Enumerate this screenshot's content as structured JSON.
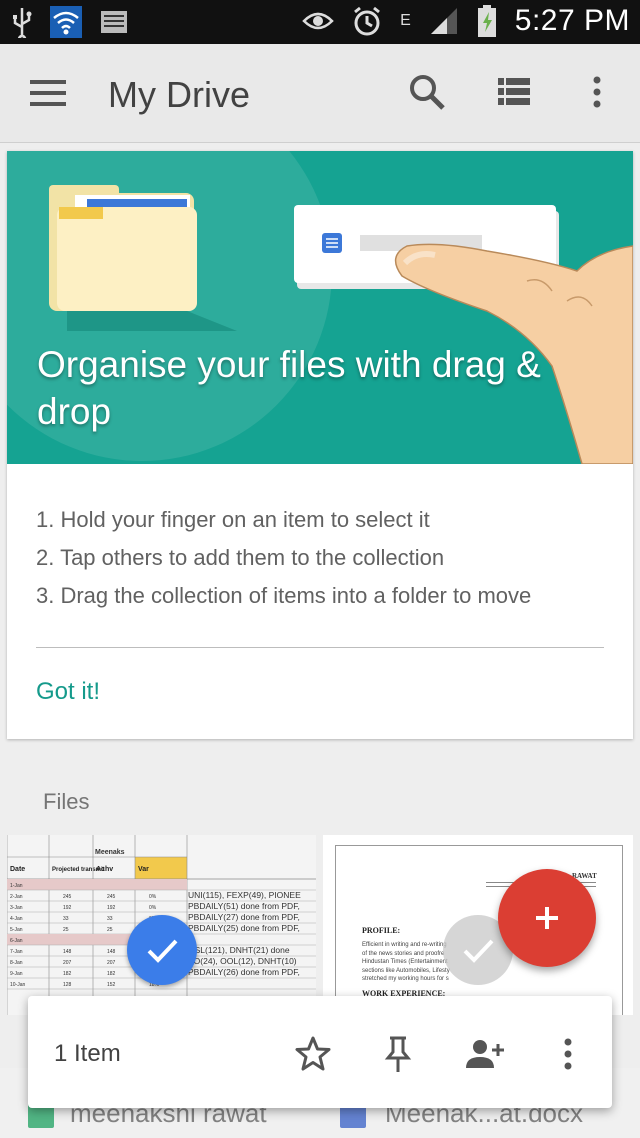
{
  "status_bar": {
    "time": "5:27 PM",
    "network": "E"
  },
  "app_bar": {
    "title": "My Drive"
  },
  "banner": {
    "title": "Organise your files with drag & drop"
  },
  "steps": [
    "1. Hold your finger on an item to select it",
    "2. Tap others to add them to the collection",
    "3. Drag the collection of items into a folder to move"
  ],
  "got_it_label": "Got it!",
  "files_section_label": "Files",
  "spreadsheet": {
    "header_group": "Meenaks",
    "columns": [
      "Date",
      "Projected transmit",
      "Achv",
      "Var"
    ],
    "rows": [
      [
        "1-Jan",
        "",
        "",
        ""
      ],
      [
        "2-Jan",
        "245",
        "245",
        "0%"
      ],
      [
        "3-Jan",
        "192",
        "192",
        "0%"
      ],
      [
        "4-Jan",
        "33",
        "33",
        "0%"
      ],
      [
        "5-Jan",
        "25",
        "25",
        "0%"
      ],
      [
        "6-Jan",
        "",
        "",
        ""
      ],
      [
        "7-Jan",
        "148",
        "148",
        "0%"
      ],
      [
        "8-Jan",
        "207",
        "207",
        "0%"
      ],
      [
        "9-Jan",
        "182",
        "182",
        "0%"
      ],
      [
        "10-Jan",
        "128",
        "152",
        "18%"
      ]
    ],
    "notes": [
      "UNI(115), FEXP(49), PIONEE",
      "PBDAILY(51) done from PDF,",
      "PBDAILY(27) done from PDF,",
      "PBDAILY(25) done from PDF,",
      "",
      "OSL(121), DNHT(21) done",
      "SO(24), OOL(12), DNHT(10)",
      "PBDAILY(26) done from PDF,"
    ]
  },
  "document": {
    "name_fragment": "RAWAT",
    "profile_heading": "PROFILE:",
    "profile_text": [
      "Efficient in writing and re-writing",
      "of the news stories and proofre",
      "Hindustan Times (Entertainment",
      "sections like Automobiles, Lifesty",
      "stretched my working hours for s"
    ],
    "work_heading": "WORK EXPERIENCE:"
  },
  "bottom_files": [
    "meenakshi rawat",
    "Meenak...at.docx"
  ],
  "action_bar": {
    "count_label": "1 Item"
  },
  "colors": {
    "teal": "#15a392",
    "accent_text": "#159a8b",
    "fab": "#db3e33",
    "select_blue": "#3b7de9"
  }
}
